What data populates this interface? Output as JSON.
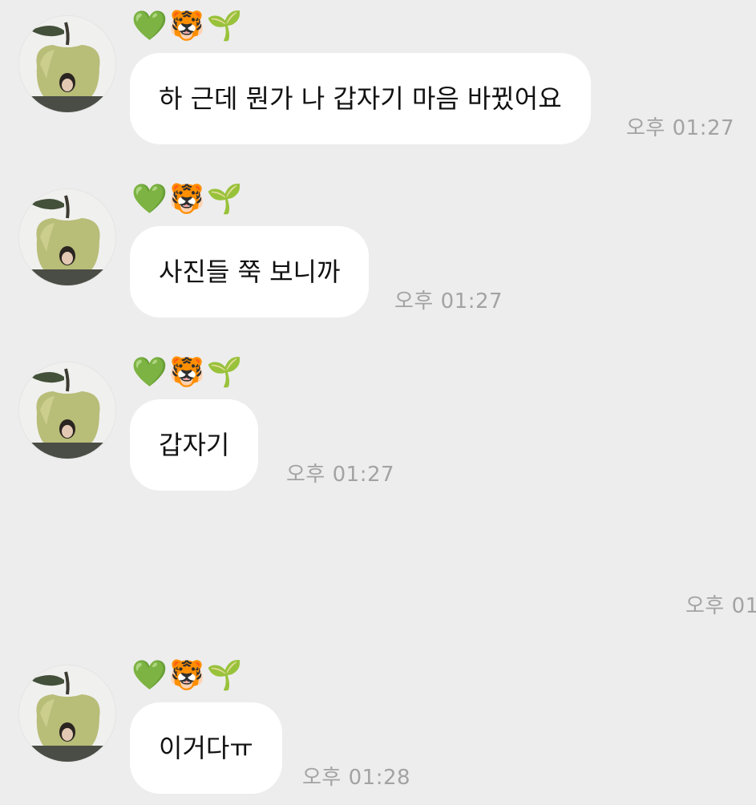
{
  "sender": {
    "name": "💚🐯🌱"
  },
  "messages": [
    {
      "text": "하 근데 뭔가 나 갑자기 마음 바뀠어요",
      "time": "오후 01:27"
    },
    {
      "text": "사진들 쭉 보니까",
      "time": "오후 01:27"
    },
    {
      "text": "갑자기",
      "time": "오후 01:27"
    },
    {
      "text": "이거다ㅠ",
      "time": "오후 01:28"
    }
  ],
  "orphan_time": "오후 01"
}
